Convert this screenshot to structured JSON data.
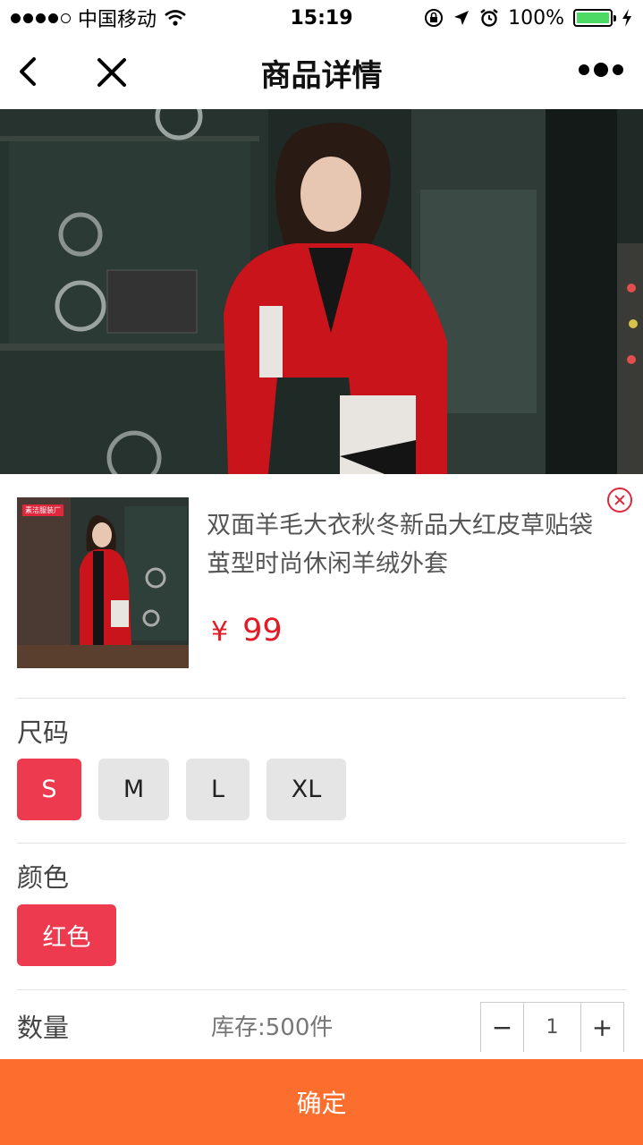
{
  "status_bar": {
    "carrier": "中国移动",
    "time": "15:19",
    "battery": "100%",
    "battery_level": 1.0
  },
  "nav": {
    "title": "商品详情"
  },
  "product": {
    "title": "双面羊毛大衣秋冬新品大红皮草贴袋茧型时尚休闲羊绒外套",
    "currency": "¥",
    "price": "99",
    "thumb_badge": "素洁服装厂"
  },
  "size": {
    "label": "尺码",
    "options": [
      "S",
      "M",
      "L",
      "XL"
    ],
    "selected": "S"
  },
  "color": {
    "label": "颜色",
    "options": [
      "红色"
    ],
    "selected": "红色"
  },
  "quantity": {
    "label": "数量",
    "stock": "库存:500件",
    "minus": "−",
    "value": "1",
    "plus": "+"
  },
  "confirm_label": "确定",
  "colors": {
    "accent": "#ee3a4f",
    "price": "#e21c26",
    "confirm": "#fc6e2e"
  }
}
